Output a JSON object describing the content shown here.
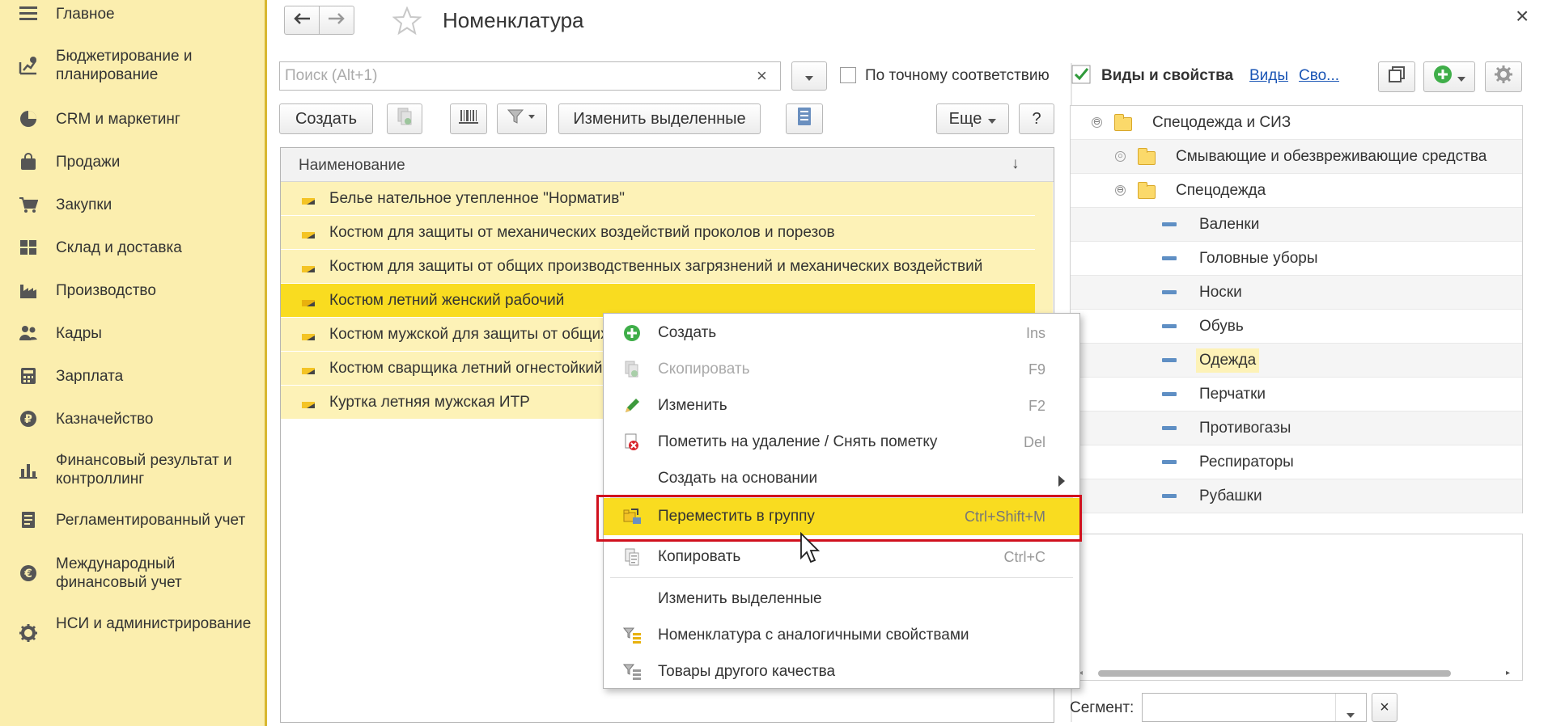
{
  "sidebar": {
    "items": [
      {
        "label": "Главное",
        "icon": "menu-icon"
      },
      {
        "label": "Бюджетирование и планирование",
        "icon": "budget-icon"
      },
      {
        "label": "CRM и маркетинг",
        "icon": "pie-chart-icon"
      },
      {
        "label": "Продажи",
        "icon": "bag-icon"
      },
      {
        "label": "Закупки",
        "icon": "cart-icon"
      },
      {
        "label": "Склад и доставка",
        "icon": "warehouse-icon"
      },
      {
        "label": "Производство",
        "icon": "factory-icon"
      },
      {
        "label": "Кадры",
        "icon": "people-icon"
      },
      {
        "label": "Зарплата",
        "icon": "calculator-icon"
      },
      {
        "label": "Казначейство",
        "icon": "ruble-icon"
      },
      {
        "label": "Финансовый результат и контроллинг",
        "icon": "bar-chart-icon"
      },
      {
        "label": "Регламентированный учет",
        "icon": "document-icon"
      },
      {
        "label": "Международный финансовый учет",
        "icon": "euro-icon"
      },
      {
        "label": "НСИ и администрирование",
        "icon": "gear-icon"
      }
    ]
  },
  "window": {
    "title": "Номенклатура",
    "close_glyph": "×"
  },
  "search": {
    "placeholder": "Поиск (Alt+1)",
    "value": "",
    "clear_glyph": "×",
    "exact_match_label": "По точному соответствию"
  },
  "toolbar": {
    "create_label": "Создать",
    "edit_selected_label": "Изменить выделенные",
    "more_label": "Еще",
    "help_label": "?"
  },
  "list": {
    "column_header": "Наименование",
    "sort_glyph": "↓",
    "rows": [
      {
        "name": "Белье нательное утепленное \"Норматив\""
      },
      {
        "name": "Костюм для защиты от механических воздействий проколов и порезов"
      },
      {
        "name": "Костюм для защиты от общих производственных загрязнений и механических воздействий"
      },
      {
        "name": "Костюм летний женский рабочий"
      },
      {
        "name": "Костюм мужской для защиты от общих"
      },
      {
        "name": "Костюм сварщика летний огнестойкий"
      },
      {
        "name": "Куртка летняя мужская ИТР"
      }
    ],
    "selected_index": 3
  },
  "right_panel": {
    "heading": "Виды и свойства",
    "link_kinds": "Виды",
    "link_props": "Сво...",
    "tree": [
      {
        "label": "Спецодежда и СИЗ",
        "kind": "folder",
        "expander": "⊖"
      },
      {
        "label": "Смывающие и обезвреживающие средства",
        "kind": "folder",
        "expander": "○"
      },
      {
        "label": "Спецодежда",
        "kind": "folder",
        "expander": "⊖"
      },
      {
        "label": "Валенки",
        "kind": "item"
      },
      {
        "label": "Головные уборы",
        "kind": "item"
      },
      {
        "label": "Носки",
        "kind": "item"
      },
      {
        "label": "Обувь",
        "kind": "item"
      },
      {
        "label": "Одежда",
        "kind": "item"
      },
      {
        "label": "Перчатки",
        "kind": "item"
      },
      {
        "label": "Противогазы",
        "kind": "item"
      },
      {
        "label": "Респираторы",
        "kind": "item"
      },
      {
        "label": "Рубашки",
        "kind": "item"
      }
    ],
    "segment_label": "Сегмент:"
  },
  "context_menu": {
    "items": [
      {
        "label": "Создать",
        "key": "Ins",
        "icon": "plus-circle-icon"
      },
      {
        "label": "Скопировать",
        "key": "F9",
        "icon": "copy-disabled-icon"
      },
      {
        "label": "Изменить",
        "key": "F2",
        "icon": "pencil-icon"
      },
      {
        "label": "Пометить на удаление / Снять пометку",
        "key": "Del",
        "icon": "delete-mark-icon"
      },
      {
        "label": "Создать на основании",
        "key": "",
        "icon": ""
      },
      {
        "label": "Переместить в группу",
        "key": "Ctrl+Shift+M",
        "icon": "move-to-group-icon"
      },
      {
        "label": "Копировать",
        "key": "Ctrl+C",
        "icon": "clipboard-copy-icon"
      },
      {
        "label": "Изменить выделенные",
        "key": "",
        "icon": ""
      },
      {
        "label": "Номенклатура с аналогичными свойствами",
        "key": "",
        "icon": "filter-list-icon"
      },
      {
        "label": "Товары другого качества",
        "key": "",
        "icon": "filter-list-icon"
      }
    ]
  },
  "colors": {
    "sidebar_bg": "#fbeeae",
    "row_bg": "#fdf2b7",
    "selected_bg": "#f9dc20",
    "highlight_border": "#d0101d",
    "link": "#1a55b5"
  }
}
